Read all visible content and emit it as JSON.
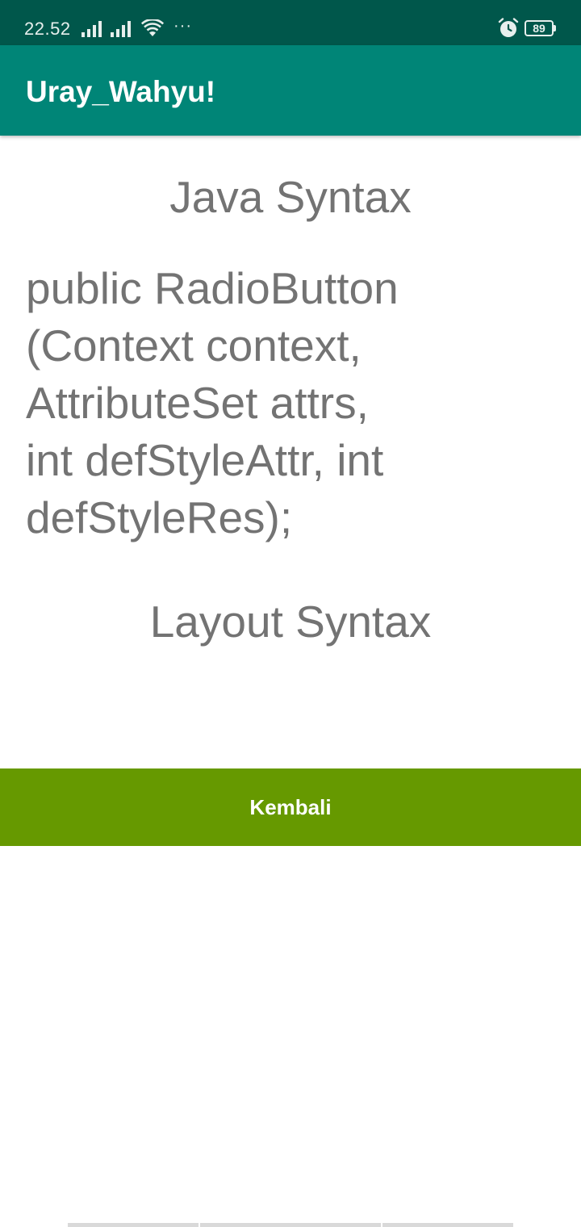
{
  "status_bar": {
    "time": "22.52",
    "more": "···",
    "battery": "89",
    "icons": [
      "signal-icon",
      "signal-icon",
      "wifi-icon",
      "alarm-icon",
      "battery-icon"
    ]
  },
  "app_bar": {
    "title": "Uray_Wahyu!"
  },
  "content": {
    "java_heading": "Java Syntax",
    "java_code": "public RadioButton\n(Context context,\nAttributeSet attrs,\nint defStyleAttr, int\ndefStyleRes);",
    "layout_heading": "Layout Syntax"
  },
  "button": {
    "label": "Kembali"
  },
  "colors": {
    "status_bar": "#00574b",
    "app_bar": "#008577",
    "button": "#669900",
    "body_text": "#737373"
  }
}
